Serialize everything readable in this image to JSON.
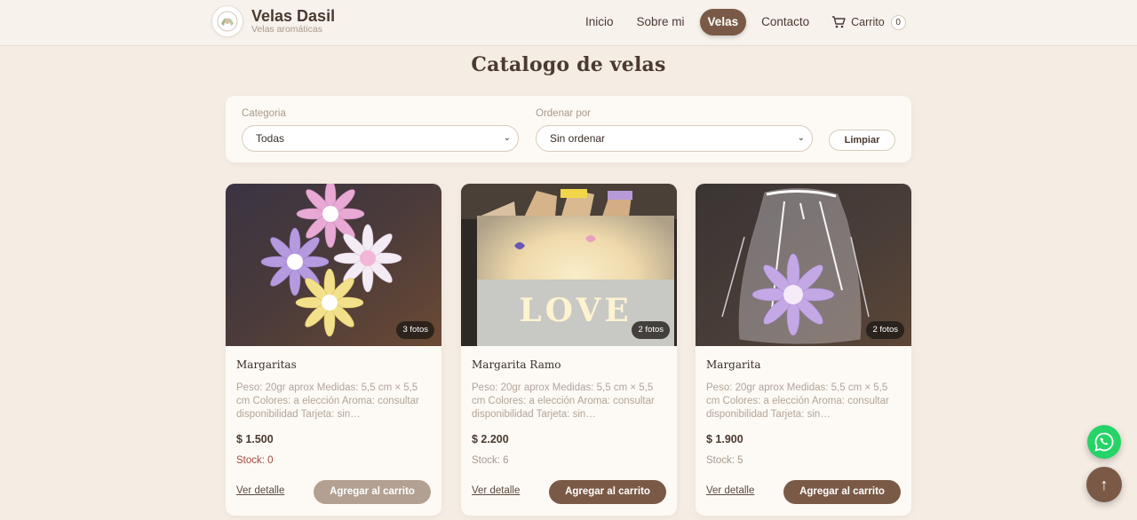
{
  "header": {
    "brand_name": "Velas Dasil",
    "brand_sub": "Velas aromáticas",
    "nav": [
      {
        "label": "Inicio",
        "active": false
      },
      {
        "label": "Sobre mi",
        "active": false
      },
      {
        "label": "Velas",
        "active": true
      },
      {
        "label": "Contacto",
        "active": false
      }
    ],
    "cart_label": "Carrito",
    "cart_count": "0"
  },
  "page_title": "Catalogo de velas",
  "filter": {
    "category_label": "Categoria",
    "category_value": "Todas",
    "sort_label": "Ordenar por",
    "sort_value": "Sin ordenar",
    "clear_label": "Limpiar"
  },
  "products": [
    {
      "name": "Margaritas",
      "photos": "3 fotos",
      "description": "Peso: 20gr aprox Medidas: 5,5 cm × 5,5 cm Colores: a elección Aroma: consultar disponibilidad Tarjeta: sin…",
      "price": "$ 1.500",
      "stock": "Stock: 0",
      "detail_label": "Ver detalle",
      "add_label": "Agregar al carrito",
      "available": false
    },
    {
      "name": "Margarita Ramo",
      "photos": "2 fotos",
      "description": "Peso: 20gr aprox Medidas: 5,5 cm × 5,5 cm Colores: a elección Aroma: consultar disponibilidad Tarjeta: sin…",
      "price": "$ 2.200",
      "stock": "Stock: 6",
      "detail_label": "Ver detalle",
      "add_label": "Agregar al carrito",
      "available": true
    },
    {
      "name": "Margarita",
      "photos": "2 fotos",
      "description": "Peso: 20gr aprox Medidas: 5,5 cm × 5,5 cm Colores: a elección Aroma: consultar disponibilidad Tarjeta: sin…",
      "price": "$ 1.900",
      "stock": "Stock: 5",
      "detail_label": "Ver detalle",
      "add_label": "Agregar al carrito",
      "available": true
    }
  ],
  "love_text": "LOVE",
  "floating": {
    "back_to_top": "↑"
  },
  "colors": {
    "accent": "#7a5a46",
    "background": "#f5ede4",
    "whatsapp": "#25d366"
  }
}
